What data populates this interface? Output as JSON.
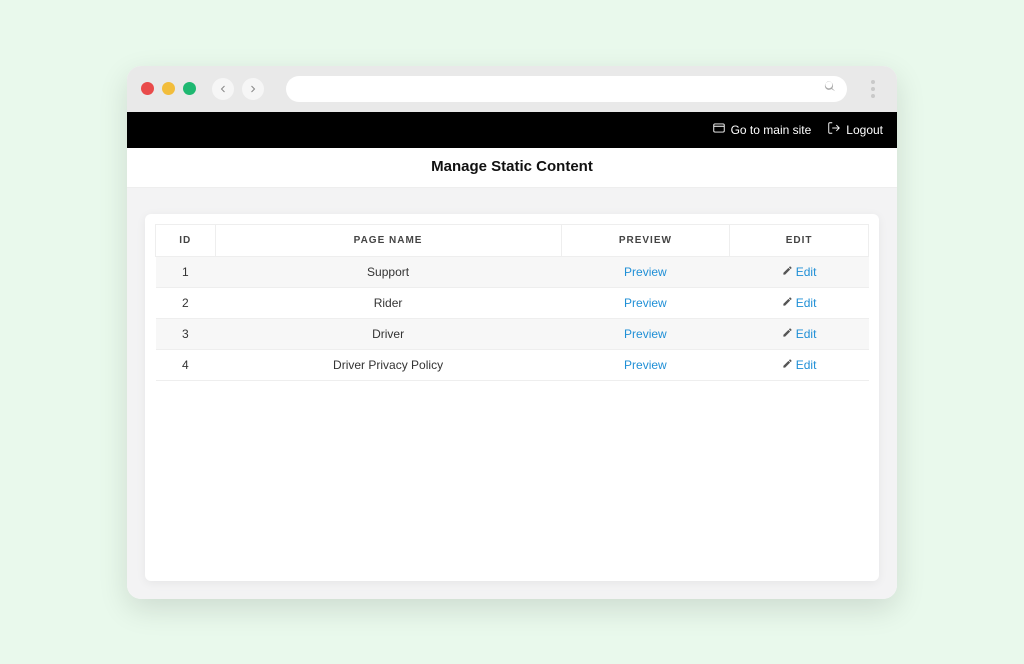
{
  "header": {
    "main_site_label": "Go to main site",
    "logout_label": "Logout"
  },
  "page": {
    "title": "Manage Static Content"
  },
  "table": {
    "headers": {
      "id": "ID",
      "page_name": "Page Name",
      "preview": "Preview",
      "edit": "Edit"
    },
    "preview_link_label": "Preview",
    "edit_link_label": "Edit",
    "rows": [
      {
        "id": "1",
        "name": "Support"
      },
      {
        "id": "2",
        "name": "Rider"
      },
      {
        "id": "3",
        "name": "Driver"
      },
      {
        "id": "4",
        "name": "Driver Privacy Policy"
      }
    ]
  }
}
